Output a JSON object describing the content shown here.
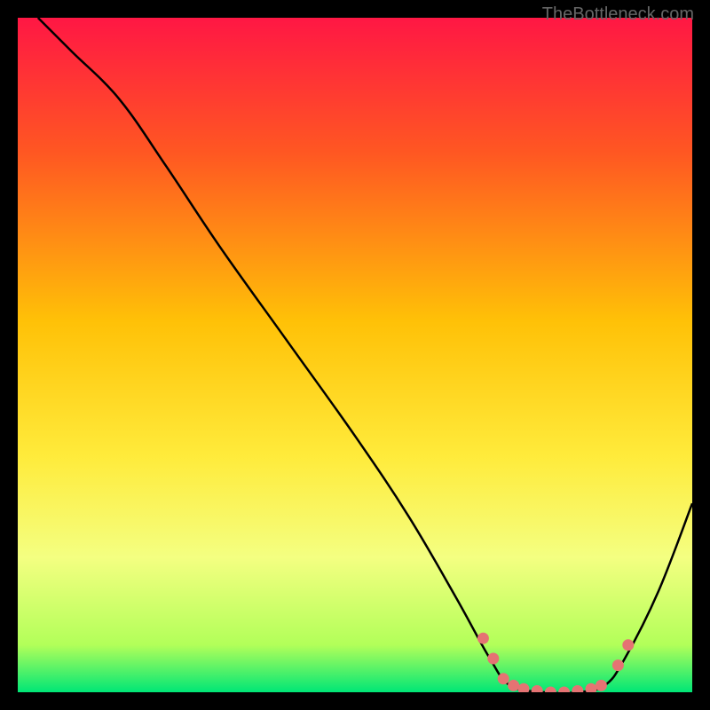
{
  "attribution": "TheBottleneck.com",
  "chart_data": {
    "type": "line",
    "title": "",
    "xlabel": "",
    "ylabel": "",
    "xlim": [
      0,
      100
    ],
    "ylim": [
      0,
      100
    ],
    "background_gradient": {
      "stops": [
        {
          "offset": 0,
          "color": "#ff1744"
        },
        {
          "offset": 20,
          "color": "#ff5722"
        },
        {
          "offset": 45,
          "color": "#ffc107"
        },
        {
          "offset": 65,
          "color": "#ffeb3b"
        },
        {
          "offset": 80,
          "color": "#f4ff81"
        },
        {
          "offset": 93,
          "color": "#b2ff59"
        },
        {
          "offset": 100,
          "color": "#00e676"
        }
      ]
    },
    "curve": [
      {
        "x": 3,
        "y": 100
      },
      {
        "x": 8,
        "y": 95
      },
      {
        "x": 15,
        "y": 88
      },
      {
        "x": 22,
        "y": 78
      },
      {
        "x": 30,
        "y": 66
      },
      {
        "x": 40,
        "y": 52
      },
      {
        "x": 50,
        "y": 38
      },
      {
        "x": 58,
        "y": 26
      },
      {
        "x": 65,
        "y": 14
      },
      {
        "x": 70,
        "y": 5
      },
      {
        "x": 73,
        "y": 1
      },
      {
        "x": 78,
        "y": 0
      },
      {
        "x": 83,
        "y": 0
      },
      {
        "x": 87,
        "y": 1
      },
      {
        "x": 90,
        "y": 5
      },
      {
        "x": 95,
        "y": 15
      },
      {
        "x": 100,
        "y": 28
      }
    ],
    "markers": [
      {
        "x": 69,
        "y": 8
      },
      {
        "x": 70.5,
        "y": 5
      },
      {
        "x": 72,
        "y": 2
      },
      {
        "x": 73.5,
        "y": 1
      },
      {
        "x": 75,
        "y": 0.5
      },
      {
        "x": 77,
        "y": 0.2
      },
      {
        "x": 79,
        "y": 0
      },
      {
        "x": 81,
        "y": 0
      },
      {
        "x": 83,
        "y": 0.2
      },
      {
        "x": 85,
        "y": 0.5
      },
      {
        "x": 86.5,
        "y": 1
      },
      {
        "x": 89,
        "y": 4
      },
      {
        "x": 90.5,
        "y": 7
      }
    ]
  }
}
